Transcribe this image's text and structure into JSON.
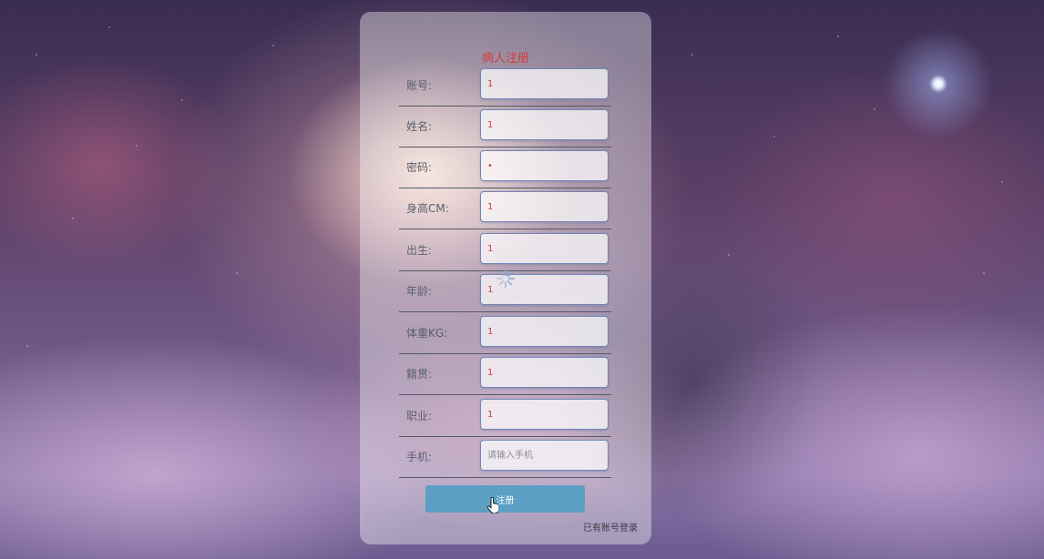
{
  "page": {
    "title": "病人注册",
    "submit_label": "注册",
    "login_link": "已有账号登录"
  },
  "form": {
    "fields": [
      {
        "label": "账号:",
        "value": "1",
        "placeholder": ""
      },
      {
        "label": "姓名:",
        "value": "1",
        "placeholder": ""
      },
      {
        "label": "密码:",
        "value": "•",
        "placeholder": ""
      },
      {
        "label": "身高CM:",
        "value": "1",
        "placeholder": ""
      },
      {
        "label": "出生:",
        "value": "1",
        "placeholder": ""
      },
      {
        "label": "年龄:",
        "value": "1",
        "placeholder": ""
      },
      {
        "label": "体重KG:",
        "value": "1",
        "placeholder": ""
      },
      {
        "label": "籍贯:",
        "value": "1",
        "placeholder": ""
      },
      {
        "label": "职业:",
        "value": "1",
        "placeholder": ""
      },
      {
        "label": "手机:",
        "value": "",
        "placeholder": "请输入手机"
      }
    ]
  },
  "colors": {
    "title": "#d63a3a",
    "button": "#5ba0c4",
    "input_text": "#d63a3a",
    "row_divider": "#555a66"
  },
  "icons": {
    "spinner": "loading-spinner-icon",
    "cursor": "hand-pointer-cursor-icon"
  }
}
